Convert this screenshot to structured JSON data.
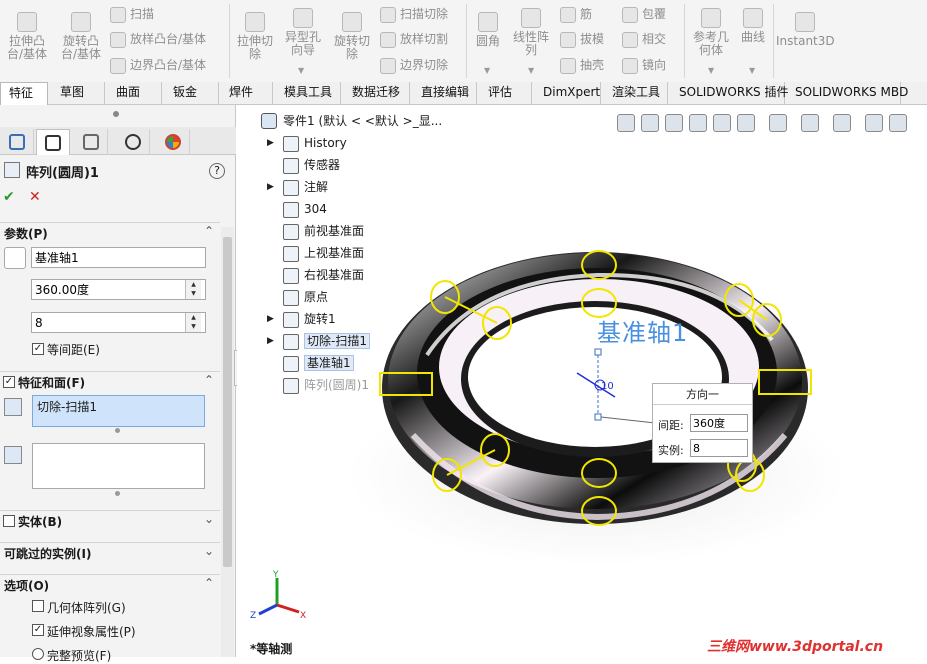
{
  "ribbon": {
    "buttons": [
      {
        "label1": "拉伸凸",
        "label2": "台/基体",
        "icon": "extrude-boss-icon"
      },
      {
        "label1": "旋转凸",
        "label2": "台/基体",
        "icon": "revolve-boss-icon"
      },
      {
        "label1": "拉伸切",
        "label2": "除",
        "icon": "extrude-cut-icon"
      },
      {
        "label1": "异型孔",
        "label2": "向导",
        "icon": "hole-wizard-icon"
      },
      {
        "label1": "旋转切",
        "label2": "除",
        "icon": "revolve-cut-icon"
      },
      {
        "label1": "圆角",
        "label2": "",
        "icon": "fillet-icon"
      },
      {
        "label1": "线性阵",
        "label2": "列",
        "icon": "linear-pattern-icon"
      },
      {
        "label1": "参考几",
        "label2": "何体",
        "icon": "reference-geometry-icon"
      },
      {
        "label1": "曲线",
        "label2": "",
        "icon": "curves-icon"
      },
      {
        "label1": "Instant3D",
        "label2": "",
        "icon": "instant3d-icon"
      }
    ],
    "small": {
      "sweep": "扫描",
      "loft": "放样凸台/基体",
      "boundary": "边界凸台/基体",
      "sweep_cut": "扫描切除",
      "loft_cut": "放样切割",
      "boundary_cut": "边界切除",
      "rib": "筋",
      "draft": "拔模",
      "shell": "抽壳",
      "wrap": "包覆",
      "intersect": "相交",
      "mirror": "镜向"
    }
  },
  "tabs": [
    "特征",
    "草图",
    "曲面",
    "钣金",
    "焊件",
    "模具工具",
    "数据迁移",
    "直接编辑",
    "评估",
    "DimXpert",
    "渲染工具",
    "SOLIDWORKS 插件",
    "SOLIDWORKS MBD"
  ],
  "property_manager": {
    "title": "阵列(圆周)1",
    "ok_symbol": "✔",
    "cancel_symbol": "✕",
    "help_symbol": "?",
    "params": {
      "header": "参数(P)",
      "axis": "基准轴1",
      "angle": "360.00度",
      "count": "8",
      "equal_spacing_label": "等间距(E)",
      "equal_spacing_checked": true
    },
    "features": {
      "header": "特征和面(F)",
      "feature_item": "切除-扫描1"
    },
    "bodies_header": "实体(B)",
    "skip_header": "可跳过的实例(I)",
    "options": {
      "header": "选项(O)",
      "geometry_pattern": "几何体阵列(G)",
      "geometry_pattern_checked": false,
      "propagate_visual": "延伸视象属性(P)",
      "propagate_visual_checked": true,
      "full_preview": "完整预览(F)"
    }
  },
  "tree": {
    "root": "零件1  (默认 < <默认 >_显...",
    "items": [
      {
        "label": "History",
        "expand": true,
        "style": ""
      },
      {
        "label": "传感器",
        "expand": false,
        "style": ""
      },
      {
        "label": "注解",
        "expand": true,
        "style": ""
      },
      {
        "label": "304",
        "expand": false,
        "style": ""
      },
      {
        "label": "前视基准面",
        "expand": false,
        "style": ""
      },
      {
        "label": "上视基准面",
        "expand": false,
        "style": ""
      },
      {
        "label": "右视基准面",
        "expand": false,
        "style": ""
      },
      {
        "label": "原点",
        "expand": false,
        "style": ""
      },
      {
        "label": "旋转1",
        "expand": true,
        "style": ""
      },
      {
        "label": "切除-扫描1",
        "expand": true,
        "style": "sel"
      },
      {
        "label": "基准轴1",
        "expand": false,
        "style": "sel"
      },
      {
        "label": "阵列(圆周)1",
        "expand": false,
        "style": "dim"
      }
    ]
  },
  "viewport": {
    "axis_label": "基准轴1",
    "angle_tag": "10",
    "direction_box": {
      "title": "方向一",
      "spacing_label": "间距:",
      "spacing_value": "360度",
      "instances_label": "实例:",
      "instances_value": "8"
    },
    "view_name": "*等轴测",
    "watermark": "三维网www.3dportal.cn",
    "colors": {
      "selection": "#f2e600",
      "axis_label": "#4a90e0",
      "ring_dark": "#111111",
      "ring_highlight": "#f8eef6"
    }
  }
}
